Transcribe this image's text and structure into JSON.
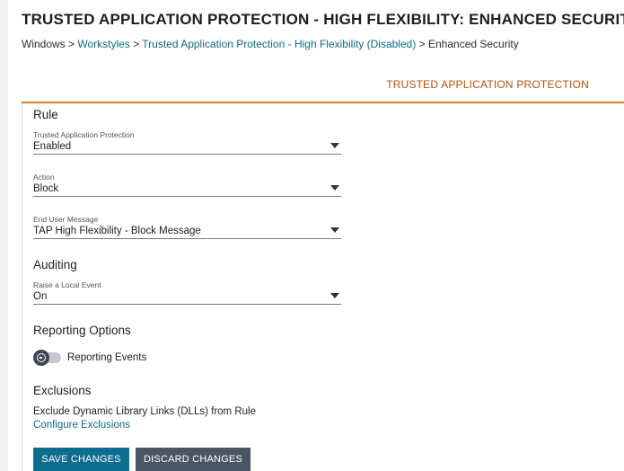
{
  "page": {
    "title": "TRUSTED APPLICATION PROTECTION - HIGH FLEXIBILITY: ENHANCED SECURITY"
  },
  "breadcrumb": {
    "root": "Windows",
    "sep1": " > ",
    "link1": "Workstyles",
    "sep2": " > ",
    "link2": "Trusted Application Protection - High Flexibility (Disabled)",
    "sep3": " > ",
    "current": "Enhanced Security"
  },
  "tab": {
    "label": "TRUSTED APPLICATION PROTECTION"
  },
  "rule": {
    "heading": "Rule",
    "fields": [
      {
        "label": "Trusted Application Protection",
        "value": "Enabled"
      },
      {
        "label": "Action",
        "value": "Block"
      },
      {
        "label": "End User Message",
        "value": "TAP High Flexibility - Block Message"
      }
    ]
  },
  "auditing": {
    "heading": "Auditing",
    "field": {
      "label": "Raise a Local Event",
      "value": "On"
    }
  },
  "reporting": {
    "heading": "Reporting Options",
    "toggle_label": "Reporting Events",
    "toggle_state": "off"
  },
  "exclusions": {
    "heading": "Exclusions",
    "text": "Exclude Dynamic Library Links (DLLs) from Rule",
    "link": "Configure Exclusions"
  },
  "actions": {
    "save_label": "SAVE CHANGES",
    "discard_label": "DISCARD CHANGES"
  },
  "colors": {
    "accent_orange": "#dd7a27",
    "link_teal": "#0f6a85",
    "save_button": "#0c6d8e",
    "discard_button": "#4a5663"
  },
  "icons": {
    "dropdown": "caret-down-icon",
    "toggle_knob": "minus-circle-icon"
  }
}
